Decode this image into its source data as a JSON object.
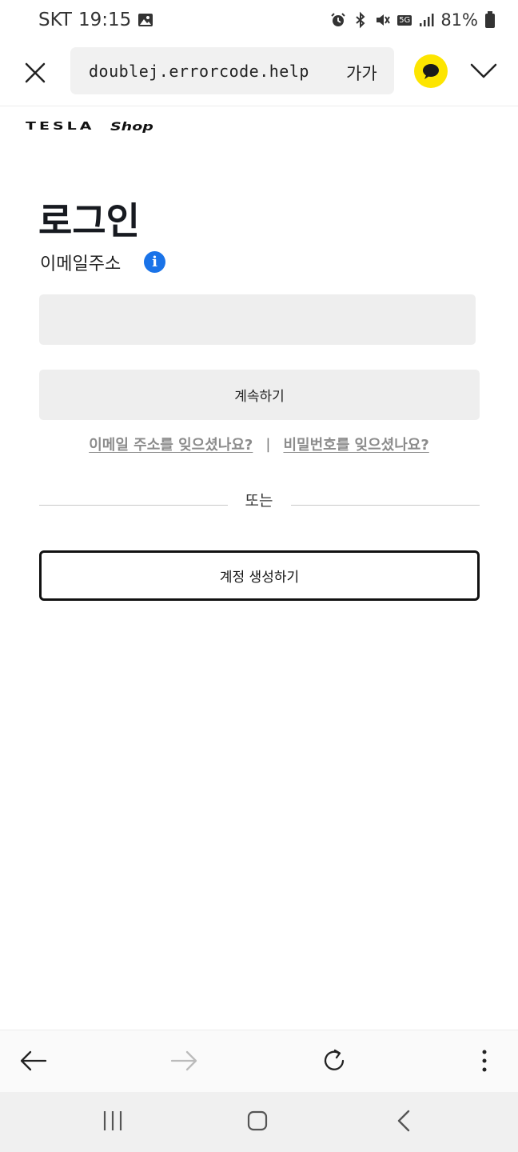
{
  "status_bar": {
    "carrier": "SKT",
    "time": "19:15",
    "network": "5G",
    "battery": "81%"
  },
  "browser": {
    "url": "doublej.errorcode.help",
    "font_size_label": "가가"
  },
  "header": {
    "brand_logo": "TESLA",
    "shop_logo": "Shop"
  },
  "login": {
    "title": "로그인",
    "email_label": "이메일주소",
    "info_icon": "i",
    "email_value": "",
    "continue_label": "계속하기",
    "forgot_email": "이메일 주소를 잊으셨나요?",
    "separator": "|",
    "forgot_password": "비밀번호를 잊으셨나요?",
    "or_text": "또는",
    "create_account_label": "계정 생성하기"
  },
  "colors": {
    "kakao_yellow": "#fde500",
    "info_blue": "#1a73e8",
    "input_bg": "#eeeeee",
    "link_gray": "#8c8c8c"
  },
  "icons": {
    "close": "close-icon",
    "menu": "chevron-down-icon",
    "back": "arrow-left-icon",
    "forward": "arrow-right-icon",
    "reload": "reload-icon",
    "more": "more-vertical-icon",
    "recents": "recents-icon",
    "home": "home-icon",
    "nav_back": "chevron-left-icon"
  }
}
